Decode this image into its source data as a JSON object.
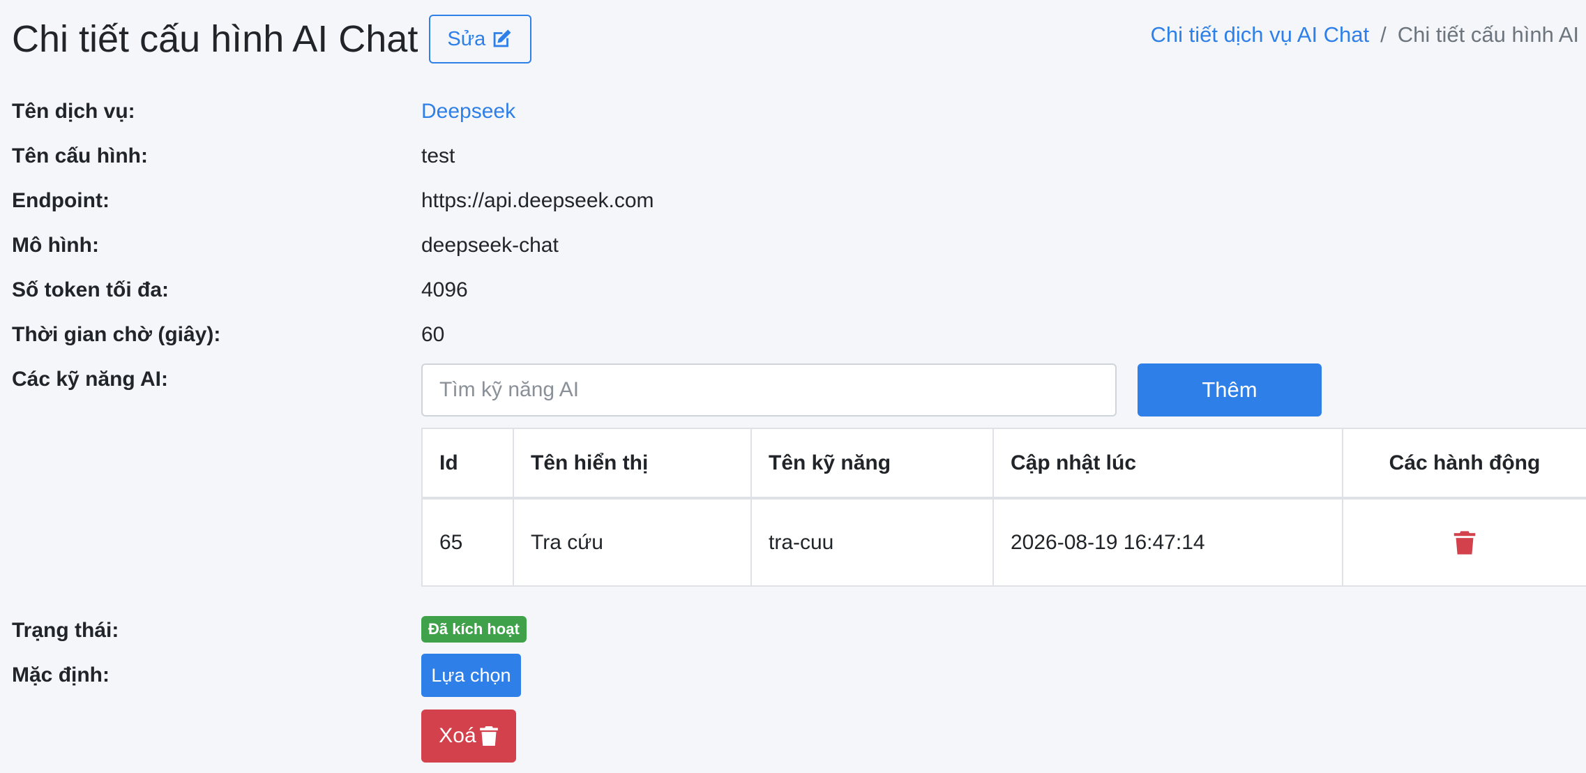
{
  "header": {
    "title": "Chi tiết cấu hình AI Chat",
    "edit_label": "Sửa"
  },
  "breadcrumb": {
    "parent": "Chi tiết dịch vụ AI Chat",
    "separator": "/",
    "current": "Chi tiết cấu hình AI"
  },
  "details": {
    "service_name_label": "Tên dịch vụ:",
    "service_name": "Deepseek",
    "config_name_label": "Tên cấu hình:",
    "config_name": "test",
    "endpoint_label": "Endpoint:",
    "endpoint": "https://api.deepseek.com",
    "model_label": "Mô hình:",
    "model": "deepseek-chat",
    "max_tokens_label": "Số token tối đa:",
    "max_tokens": "4096",
    "timeout_label": "Thời gian chờ (giây):",
    "timeout": "60",
    "skills_label": "Các kỹ năng AI:",
    "status_label": "Trạng thái:",
    "status": "Đã kích hoạt",
    "default_label": "Mặc định:"
  },
  "skills": {
    "search_placeholder": "Tìm kỹ năng AI",
    "add_label": "Thêm",
    "columns": {
      "id": "Id",
      "display_name": "Tên hiển thị",
      "skill_name": "Tên kỹ năng",
      "updated_at": "Cập nhật lúc",
      "actions": "Các hành động"
    },
    "rows": [
      {
        "id": "65",
        "display_name": "Tra cứu",
        "skill_name": "tra-cuu",
        "updated_at": "2026-08-19 16:47:14"
      }
    ]
  },
  "actions": {
    "choose_label": "Lựa chọn",
    "delete_label": "Xoá"
  },
  "colors": {
    "primary": "#2f7fe8",
    "success": "#3fa24b",
    "danger": "#d3414d"
  },
  "icons": {
    "edit": "edit-icon",
    "trash": "trash-icon"
  }
}
